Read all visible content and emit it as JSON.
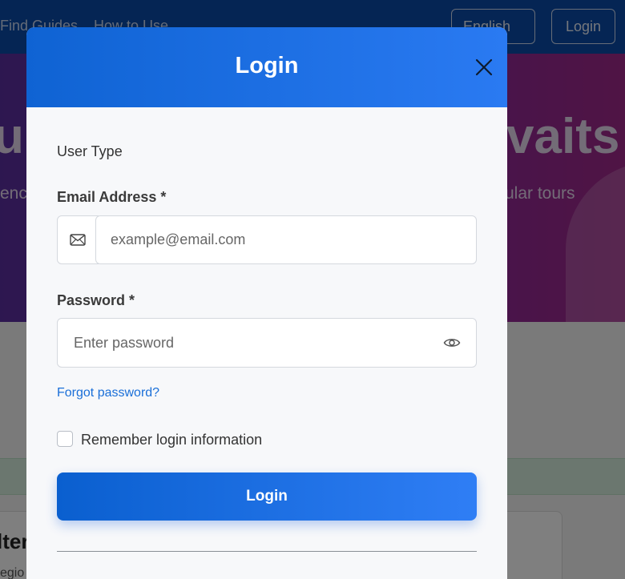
{
  "nav": {
    "link_find_guides": "Find Guides",
    "link_how_to_use": "How to Use",
    "language": "English",
    "login": "Login"
  },
  "hero": {
    "title_left": "u",
    "title_right": "vaits",
    "subtitle_left": "enc",
    "subtitle_right": "ular tours"
  },
  "filters": {
    "title": "lter",
    "subtitle": "egio"
  },
  "modal": {
    "title": "Login",
    "user_type_label": "User Type",
    "email_label": "Email Address *",
    "email_placeholder": "example@email.com",
    "email_value": "",
    "password_label": "Password *",
    "password_placeholder": "Enter password",
    "password_value": "",
    "forgot_password": "Forgot password?",
    "remember_label": "Remember login information",
    "remember_checked": false,
    "login_button": "Login"
  },
  "colors": {
    "header_gradient_start": "#0f63d3",
    "header_gradient_end": "#2a7af2",
    "link": "#1a6fd8",
    "nav_bg": "#0a4aa8"
  },
  "icons": {
    "close": "close-icon",
    "email": "mail-icon",
    "password_toggle": "eye-icon",
    "language_caret": "caret-down-icon"
  }
}
